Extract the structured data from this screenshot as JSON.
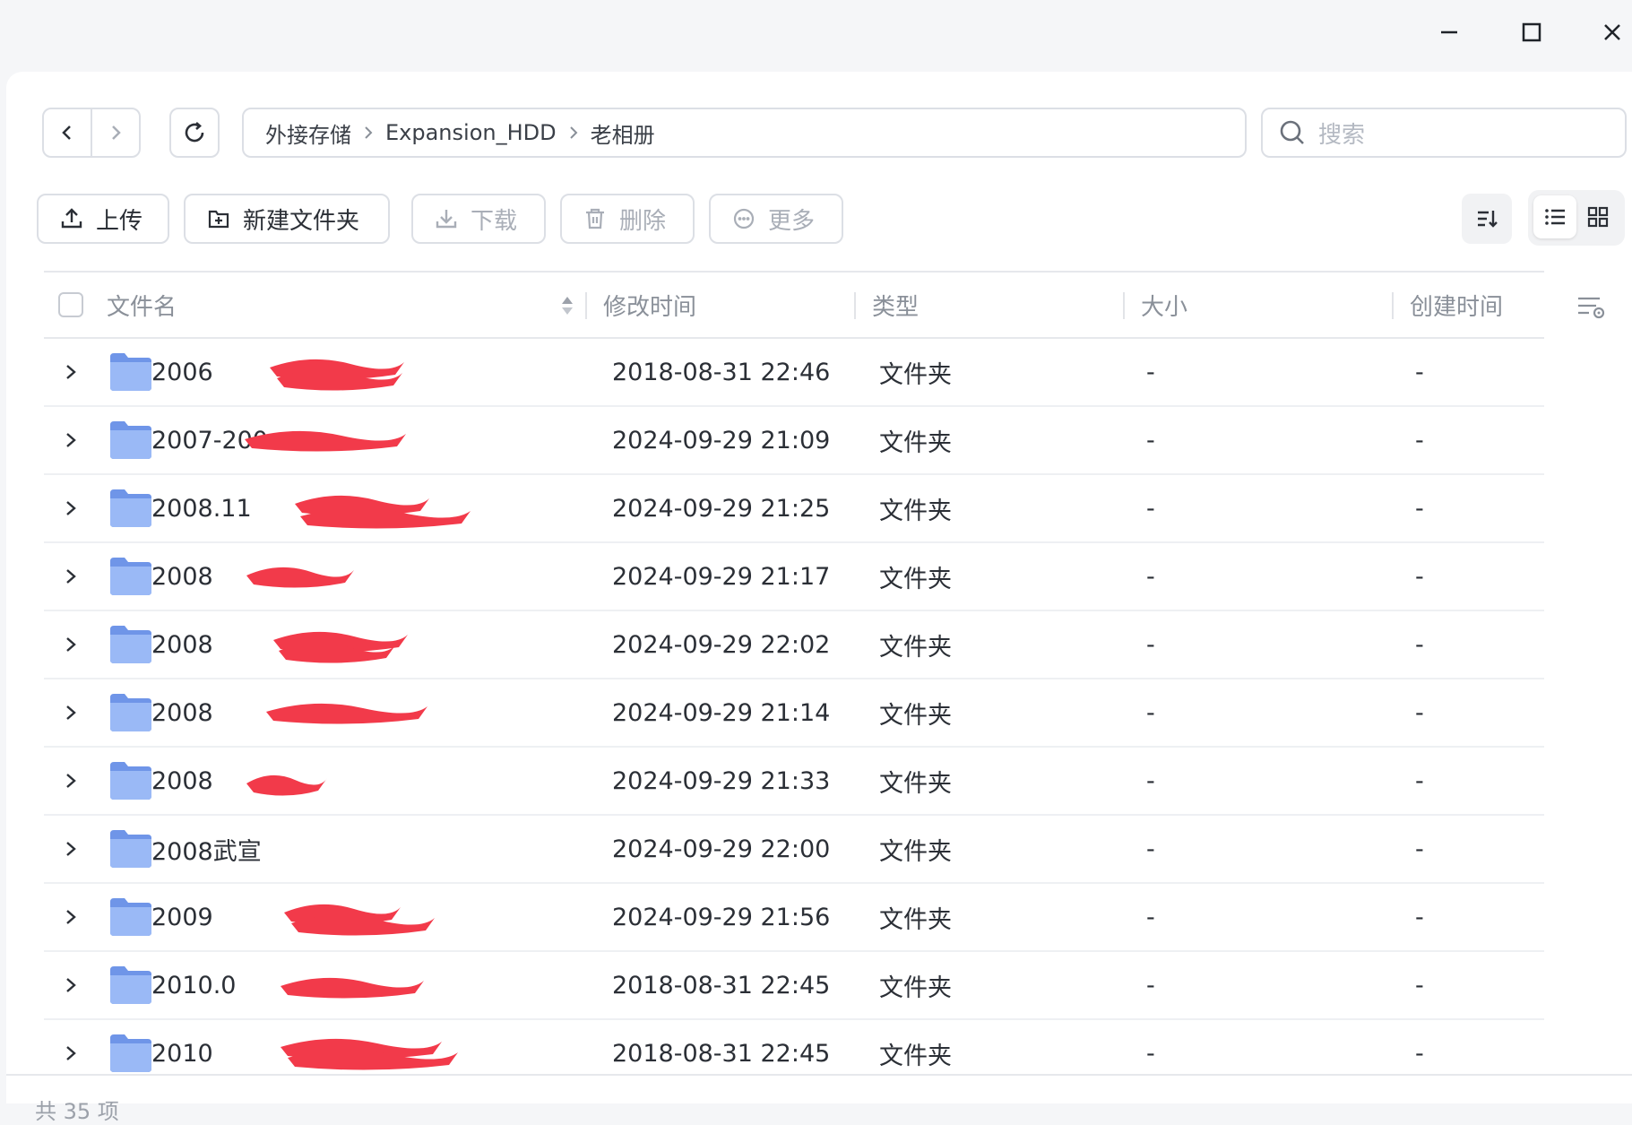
{
  "window_controls": {
    "minimize_icon": "minimize-icon",
    "maximize_icon": "maximize-icon",
    "close_icon": "close-icon"
  },
  "breadcrumb": [
    "外接存储",
    "Expansion_HDD",
    "老相册"
  ],
  "search": {
    "placeholder": "搜索"
  },
  "toolbar": {
    "upload": "上传",
    "new_folder": "新建文件夹",
    "download": "下载",
    "delete": "删除",
    "more": "更多"
  },
  "columns": {
    "name": "文件名",
    "modified": "修改时间",
    "type": "类型",
    "size": "大小",
    "created": "创建时间"
  },
  "rows": [
    {
      "name": "2006",
      "modified": "2018-08-31 22:46",
      "type": "文件夹",
      "size": "-",
      "created": "-"
    },
    {
      "name": "2007-200",
      "modified": "2024-09-29 21:09",
      "type": "文件夹",
      "size": "-",
      "created": "-"
    },
    {
      "name": "2008.11",
      "modified": "2024-09-29 21:25",
      "type": "文件夹",
      "size": "-",
      "created": "-"
    },
    {
      "name": "2008",
      "modified": "2024-09-29 21:17",
      "type": "文件夹",
      "size": "-",
      "created": "-"
    },
    {
      "name": "2008",
      "modified": "2024-09-29 22:02",
      "type": "文件夹",
      "size": "-",
      "created": "-"
    },
    {
      "name": "2008",
      "modified": "2024-09-29 21:14",
      "type": "文件夹",
      "size": "-",
      "created": "-"
    },
    {
      "name": "2008",
      "modified": "2024-09-29 21:33",
      "type": "文件夹",
      "size": "-",
      "created": "-"
    },
    {
      "name": "2008武宣",
      "modified": "2024-09-29 22:00",
      "type": "文件夹",
      "size": "-",
      "created": "-"
    },
    {
      "name": "2009",
      "modified": "2024-09-29 21:56",
      "type": "文件夹",
      "size": "-",
      "created": "-"
    },
    {
      "name": "2010.0",
      "modified": "2018-08-31 22:45",
      "type": "文件夹",
      "size": "-",
      "created": "-"
    },
    {
      "name": "2010",
      "modified": "2018-08-31 22:45",
      "type": "文件夹",
      "size": "-",
      "created": "-"
    }
  ],
  "footer": {
    "count_text": "共 35 项"
  },
  "colors": {
    "accent": "#4d7cfe",
    "folder": "#8fb2f5",
    "redaction": "#f23a4a",
    "border": "#dcdfe5"
  }
}
